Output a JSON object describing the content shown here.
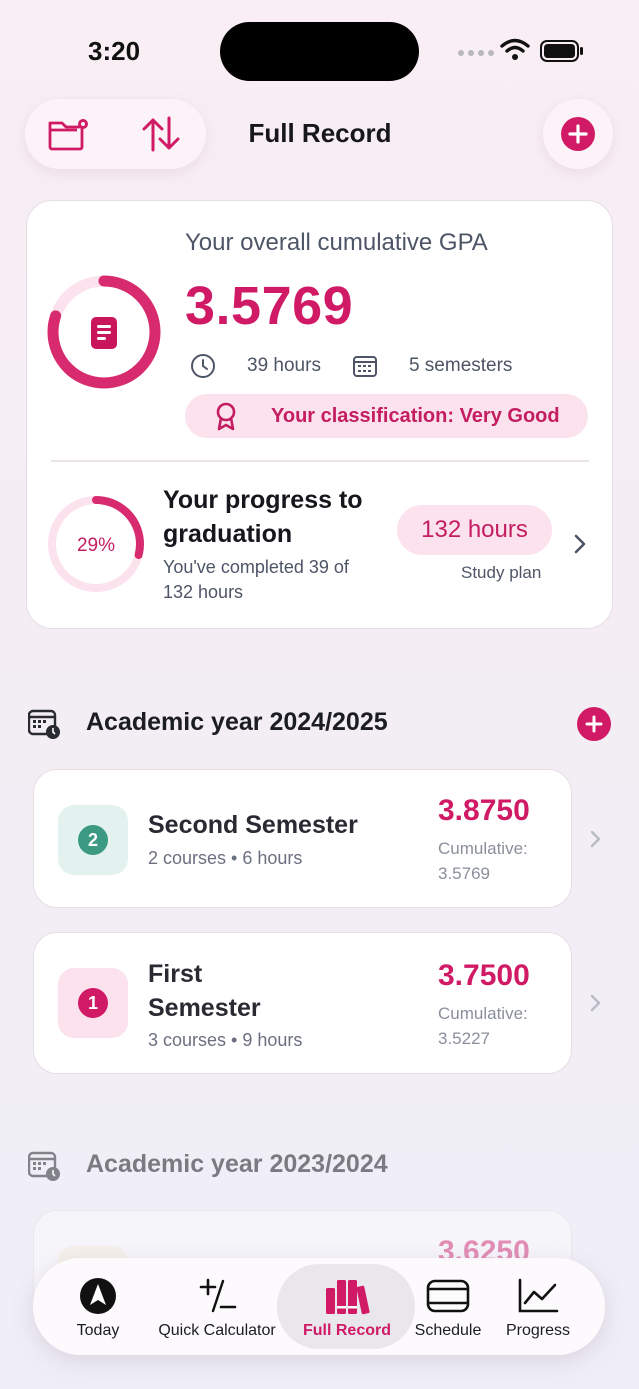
{
  "status": {
    "time": "3:20"
  },
  "header": {
    "title": "Full Record"
  },
  "summary": {
    "label": "Your overall cumulative GPA",
    "gpa": "3.5769",
    "hours": "39 hours",
    "semesters": "5 semesters",
    "classification": "Your classification: Very Good",
    "gpa_ring_fill": 0.8,
    "progress_title": "Your progress to graduation",
    "progress_percent": "29%",
    "progress_fraction": 0.29,
    "progress_sub": "You've completed 39 of 132 hours",
    "total_hours": "132 hours",
    "study_plan": "Study plan"
  },
  "years": [
    {
      "title": "Academic year 2024/2025",
      "semesters": [
        {
          "number": "2",
          "name": "Second Semester",
          "sub": "2 courses • 6 hours",
          "gpa": "3.8750",
          "cum_label": "Cumulative:",
          "cum_value": "3.5769",
          "badge_bg": "#e3f2ee",
          "badge_circle": "#3c9a82"
        },
        {
          "number": "1",
          "name": "First Semester",
          "sub": "3 courses • 9 hours",
          "gpa": "3.7500",
          "cum_label": "Cumulative:",
          "cum_value": "3.5227",
          "badge_bg": "#fbe2ec",
          "badge_circle": "#d11a66"
        }
      ]
    },
    {
      "title": "Academic year 2023/2024",
      "semesters": [
        {
          "gpa": "3.6250"
        }
      ]
    }
  ],
  "tabs": [
    {
      "label": "Today",
      "icon": "compass-icon"
    },
    {
      "label": "Quick Calculator",
      "icon": "plus-minus-icon"
    },
    {
      "label": "Full Record",
      "icon": "books-icon",
      "active": true
    },
    {
      "label": "Schedule",
      "icon": "schedule-icon"
    },
    {
      "label": "Progress",
      "icon": "chart-icon"
    }
  ],
  "colors": {
    "accent": "#d11a66",
    "accent_light": "#fbe2ec"
  }
}
